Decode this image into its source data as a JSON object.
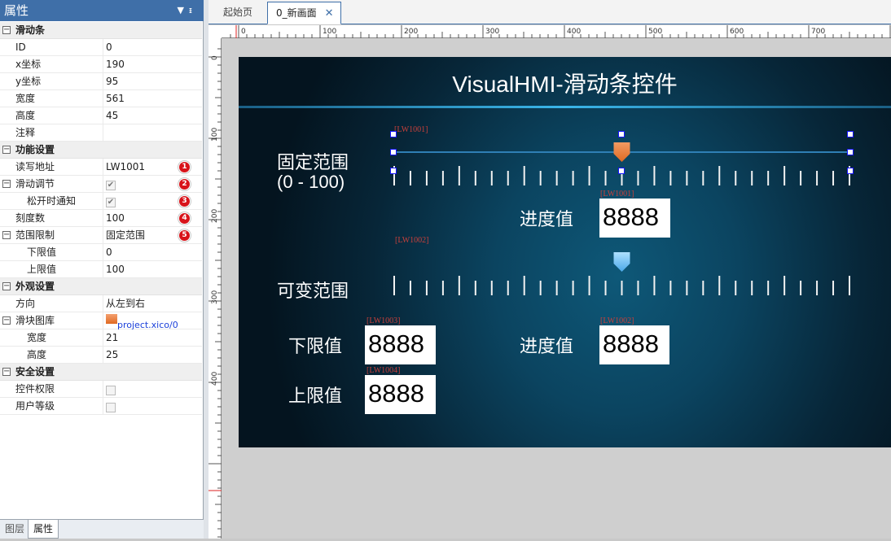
{
  "panel": {
    "title": "属性",
    "pin_icon": "pin-icon",
    "sections": [
      {
        "title": "滑动条",
        "rows": [
          {
            "key": "ID",
            "value": "0"
          },
          {
            "key": "x坐标",
            "value": "190"
          },
          {
            "key": "y坐标",
            "value": "95"
          },
          {
            "key": "宽度",
            "value": "561"
          },
          {
            "key": "高度",
            "value": "45"
          },
          {
            "key": "注释",
            "value": ""
          }
        ]
      },
      {
        "title": "功能设置",
        "rows": [
          {
            "key": "读写地址",
            "value": "LW1001",
            "badge": "1"
          },
          {
            "key": "滑动调节",
            "checked": true,
            "badge": "2",
            "expandable": true
          },
          {
            "key": "松开时通知",
            "checked": true,
            "badge": "3",
            "indent": true
          },
          {
            "key": "刻度数",
            "value": "100",
            "badge": "4"
          },
          {
            "key": "范围限制",
            "value": "固定范围",
            "badge": "5",
            "expandable": true
          },
          {
            "key": "下限值",
            "value": "0",
            "indent": true
          },
          {
            "key": "上限值",
            "value": "100",
            "indent": true
          }
        ]
      },
      {
        "title": "外观设置",
        "rows": [
          {
            "key": "方向",
            "value": "从左到右"
          },
          {
            "key": "滑块图库",
            "value": "project.xico/0",
            "expandable": true
          },
          {
            "key": "宽度",
            "value": "21",
            "indent": true
          },
          {
            "key": "高度",
            "value": "25",
            "indent": true
          }
        ]
      },
      {
        "title": "安全设置",
        "rows": [
          {
            "key": "控件权限",
            "checked": false
          },
          {
            "key": "用户等级",
            "checked": false
          }
        ]
      }
    ],
    "bottom_tabs": [
      "图层",
      "属性"
    ]
  },
  "doc_tabs": [
    {
      "label": "起始页",
      "active": false
    },
    {
      "label": "0_新画面",
      "active": true
    }
  ],
  "ruler": {
    "h_labels": [
      "0",
      "100",
      "200",
      "300",
      "400",
      "500",
      "600",
      "700"
    ],
    "v_labels": [
      "0",
      "100",
      "200",
      "300",
      "400"
    ]
  },
  "hmi": {
    "title": "VisualHMI-滑动条控件",
    "slider1": {
      "label_line1": "固定范围",
      "label_line2": "(0 - 100)",
      "tag": "[LW1001]",
      "value": 50
    },
    "progress1": {
      "label": "进度值",
      "tag": "[LW1001]",
      "display": "8888"
    },
    "slider2": {
      "label": "可变范围",
      "tag": "[LW1002]",
      "value": 50
    },
    "lower": {
      "label": "下限值",
      "tag": "[LW1003]",
      "display": "8888"
    },
    "progress2": {
      "label": "进度值",
      "tag": "[LW1002]",
      "display": "8888"
    },
    "upper": {
      "label": "上限值",
      "tag": "[LW1004]",
      "display": "8888"
    }
  },
  "colors": {
    "panel_title": "#3f6fa8",
    "screen_dark": "#04141f",
    "screen_mid": "#0e5878",
    "thumb_orange": "#e8732a",
    "thumb_blue": "#5fb6ee",
    "tag_red": "#c9403b",
    "badge_red": "#d8131a"
  }
}
